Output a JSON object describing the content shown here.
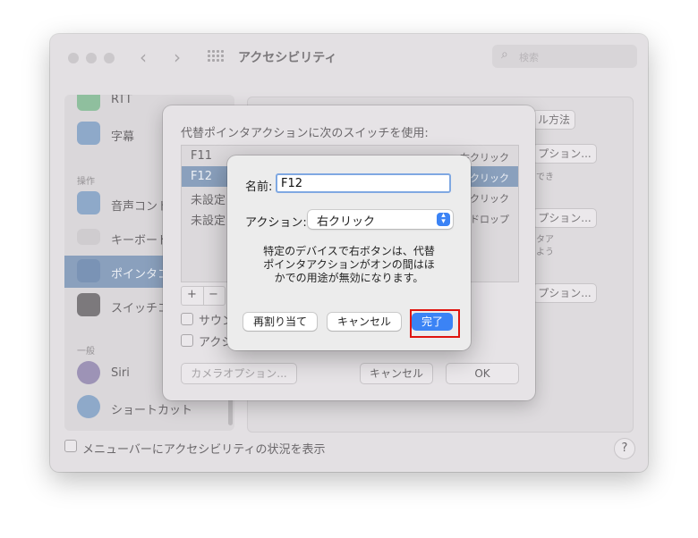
{
  "window": {
    "title": "アクセシビリティ",
    "search_placeholder": "検索"
  },
  "sidebar": {
    "items": [
      {
        "label": "RTT",
        "icon": "keyboard-icon"
      },
      {
        "label": "字幕",
        "icon": "captions-icon"
      },
      {
        "label": "音声コント",
        "icon": "voice-control-icon"
      },
      {
        "label": "キーボード",
        "icon": "keyboard-icon"
      },
      {
        "label": "ポインタコ",
        "icon": "pointer-icon",
        "selected": true
      },
      {
        "label": "スイッチコ",
        "icon": "switch-icon"
      },
      {
        "label": "Siri",
        "icon": "siri-icon"
      },
      {
        "label": "ショートカット",
        "icon": "accessibility-shortcut-icon"
      }
    ],
    "sections": [
      "操作",
      "一般"
    ]
  },
  "pane": {
    "method_button": "ル方法",
    "options_button": "プション...",
    "note1": "でき",
    "note2_line1": "タア",
    "note2_line2": "よう"
  },
  "bottom": {
    "checkbox_label": "メニューバーにアクセシビリティの状況を表示",
    "help": "?"
  },
  "sheet": {
    "title": "代替ポインタアクションに次のスイッチを使用:",
    "switches": [
      {
        "name": "F11",
        "action": "右クリック"
      },
      {
        "name": "F12",
        "action": "クリック",
        "selected": true
      },
      {
        "name": "未設定",
        "action": "クリック"
      },
      {
        "name": "未設定",
        "action": "ドロップ"
      }
    ],
    "plus": "+",
    "minus": "−",
    "checkbox1": "サウン",
    "checkbox2": "アクシ",
    "camera_options": "カメラオプション...",
    "cancel": "キャンセル",
    "ok": "OK"
  },
  "dialog": {
    "name_label": "名前:",
    "name_value": "F12",
    "action_label": "アクション:",
    "action_value": "右クリック",
    "message": "特定のデバイスで右ボタンは、代替ポインタアクションがオンの間はほかでの用途が無効になります。",
    "reassign": "再割り当て",
    "cancel": "キャンセル",
    "done": "完了"
  },
  "colors": {
    "accent": "#3b83f5",
    "highlight_box": "#e0140e"
  }
}
